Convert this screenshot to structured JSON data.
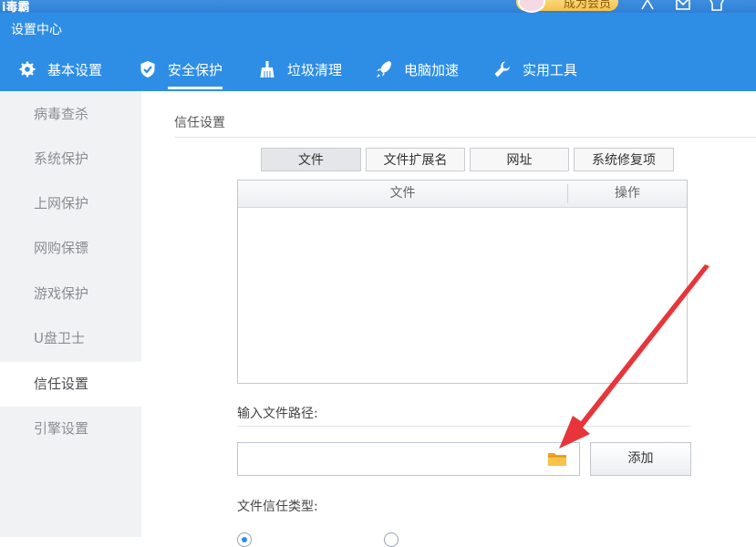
{
  "app": {
    "name": "i毒霸",
    "vip_label": "成为会员"
  },
  "window": {
    "title": "设置中心"
  },
  "nav": [
    {
      "label": "基本设置",
      "icon": "gear-icon"
    },
    {
      "label": "安全保护",
      "icon": "shield-check-icon",
      "active": true
    },
    {
      "label": "垃圾清理",
      "icon": "broom-icon"
    },
    {
      "label": "电脑加速",
      "icon": "rocket-icon"
    },
    {
      "label": "实用工具",
      "icon": "wrench-icon"
    }
  ],
  "sidebar": {
    "items": [
      {
        "label": "病毒查杀"
      },
      {
        "label": "系统保护"
      },
      {
        "label": "上网保护"
      },
      {
        "label": "网购保镖"
      },
      {
        "label": "游戏保护"
      },
      {
        "label": "U盘卫士"
      },
      {
        "label": "信任设置",
        "active": true
      },
      {
        "label": "引擎设置"
      }
    ]
  },
  "main": {
    "section_title": "信任设置",
    "tabs": [
      {
        "label": "文件",
        "active": true
      },
      {
        "label": "文件扩展名"
      },
      {
        "label": "网址"
      },
      {
        "label": "系统修复项"
      }
    ],
    "table": {
      "columns": [
        "文件",
        "操作"
      ],
      "rows": []
    },
    "path_label": "输入文件路径:",
    "path_value": "",
    "add_button": "添加",
    "trust_type_label": "文件信任类型:"
  },
  "colors": {
    "accent": "#2e8ee6",
    "arrow": "#e8353a",
    "sidebar_bg": "#f1f2f4"
  }
}
